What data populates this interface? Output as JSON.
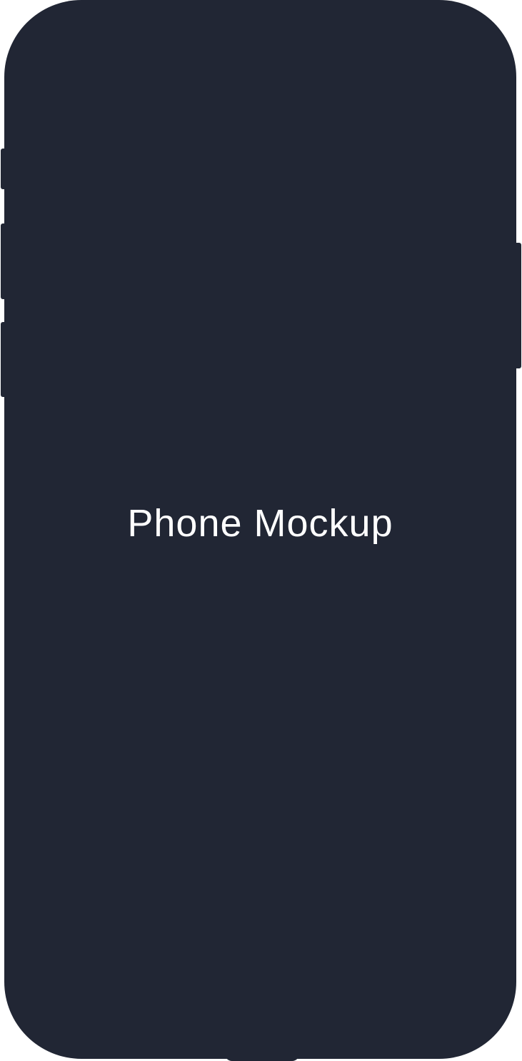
{
  "mockup": {
    "label": "Phone Mockup",
    "body_color": "#212634",
    "label_color": "#ffffff"
  }
}
